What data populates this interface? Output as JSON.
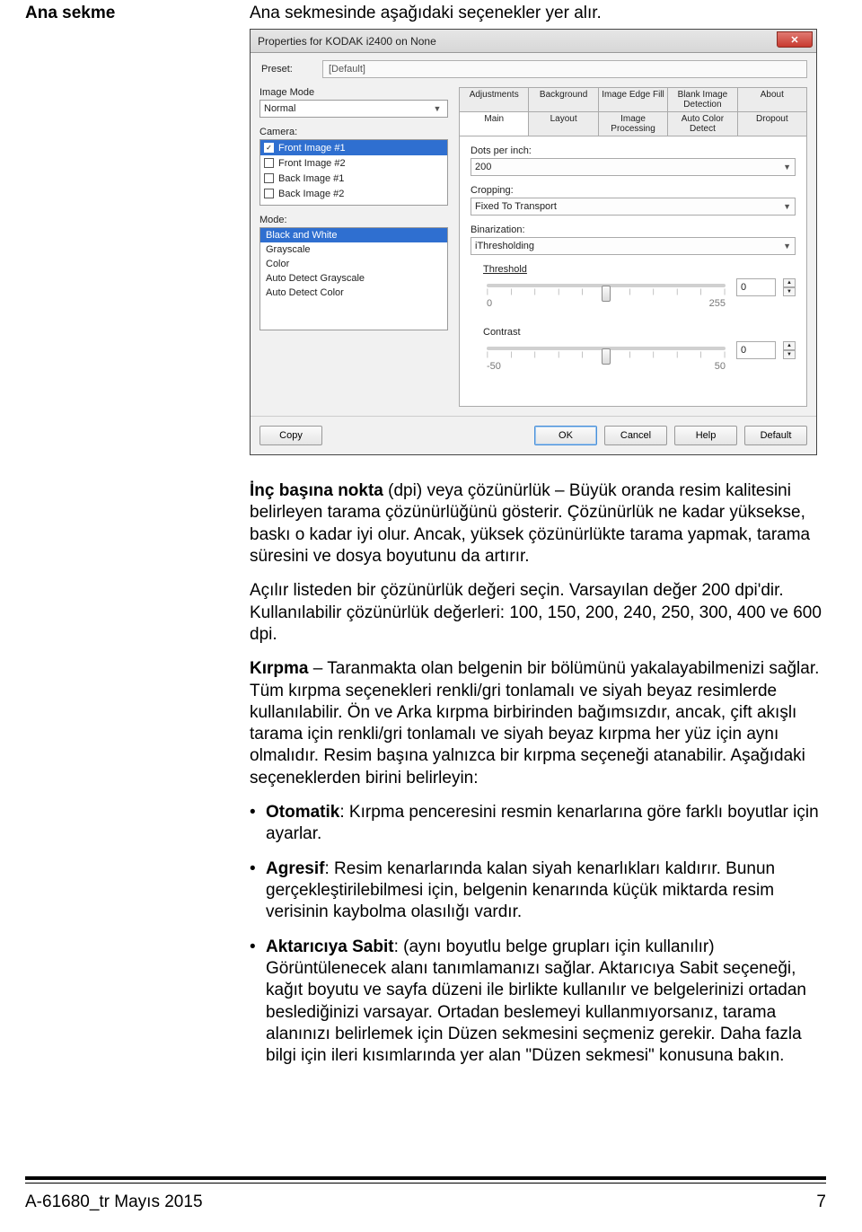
{
  "section_heading": "Ana sekme",
  "intro": "Ana sekmesinde aşağıdaki seçenekler yer alır.",
  "dialog": {
    "title": "Properties for KODAK i2400 on None",
    "close_glyph": "✕",
    "preset_label": "Preset:",
    "preset_value": "[Default]",
    "image_mode_label": "Image Mode",
    "image_mode_value": "Normal",
    "camera_label": "Camera:",
    "camera_items": [
      {
        "checked": true,
        "label": "Front Image #1",
        "selected": true
      },
      {
        "checked": false,
        "label": "Front Image #2",
        "selected": false
      },
      {
        "checked": false,
        "label": "Back Image #1",
        "selected": false
      },
      {
        "checked": false,
        "label": "Back Image #2",
        "selected": false
      }
    ],
    "mode_label": "Mode:",
    "mode_items": [
      {
        "label": "Black and White",
        "selected": true
      },
      {
        "label": "Grayscale",
        "selected": false
      },
      {
        "label": "Color",
        "selected": false
      },
      {
        "label": "Auto Detect Grayscale",
        "selected": false
      },
      {
        "label": "Auto Detect Color",
        "selected": false
      }
    ],
    "tabs_row1": [
      "Adjustments",
      "Background",
      "Image Edge Fill",
      "Blank Image Detection",
      "About"
    ],
    "tabs_row2": [
      "Main",
      "Layout",
      "Image Processing",
      "Auto Color Detect",
      "Dropout"
    ],
    "active_tab": "Main",
    "dpi_label": "Dots per inch:",
    "dpi_value": "200",
    "cropping_label": "Cropping:",
    "cropping_value": "Fixed To Transport",
    "binarization_label": "Binarization:",
    "binarization_value": "iThresholding",
    "threshold_label": "Threshold",
    "threshold_value": "0",
    "threshold_min": "0",
    "threshold_max": "255",
    "contrast_label": "Contrast",
    "contrast_value": "0",
    "contrast_min": "-50",
    "contrast_max": "50",
    "buttons": {
      "copy": "Copy",
      "ok": "OK",
      "cancel": "Cancel",
      "help": "Help",
      "default": "Default"
    }
  },
  "body": {
    "p1a": "İnç başına nokta",
    "p1b": " (dpi) veya çözünürlük – Büyük oranda resim kalitesini belirleyen tarama çözünürlüğünü gösterir. Çözünürlük ne kadar yüksekse, baskı o kadar iyi olur. Ancak, yüksek çözünürlükte tarama yapmak, tarama süresini ve dosya boyutunu da artırır.",
    "p2": "Açılır listeden bir çözünürlük değeri seçin. Varsayılan değer 200 dpi'dir. Kullanılabilir çözünürlük değerleri: 100, 150, 200, 240, 250, 300, 400 ve 600 dpi.",
    "p3a": "Kırpma",
    "p3b": " – Taranmakta olan belgenin bir bölümünü yakalayabilmenizi sağlar. Tüm kırpma seçenekleri renkli/gri tonlamalı ve siyah beyaz resimlerde kullanılabilir. Ön ve Arka kırpma birbirinden bağımsızdır, ancak, çift akışlı tarama için renkli/gri tonlamalı ve siyah beyaz kırpma her yüz için aynı olmalıdır. Resim başına yalnızca bir kırpma seçeneği atanabilir. Aşağıdaki seçeneklerden birini belirleyin:",
    "li1a": "Otomatik",
    "li1b": ": Kırpma penceresini resmin kenarlarına göre farklı boyutlar için ayarlar.",
    "li2a": "Agresif",
    "li2b": ": Resim kenarlarında kalan siyah kenarlıkları kaldırır. Bunun gerçekleştirilebilmesi için, belgenin kenarında küçük miktarda resim verisinin kaybolma olasılığı vardır.",
    "li3a": "Aktarıcıya Sabit",
    "li3b": ": (aynı boyutlu belge grupları için kullanılır) Görüntülenecek alanı tanımlamanızı sağlar. Aktarıcıya Sabit seçeneği, kağıt boyutu ve sayfa düzeni ile birlikte kullanılır ve belgelerinizi ortadan beslediğinizi varsayar. Ortadan beslemeyi kullanmıyorsanız, tarama alanınızı belirlemek için Düzen sekmesini seçmeniz gerekir. Daha fazla bilgi için ileri kısımlarında yer alan \"Düzen sekmesi\" konusuna bakın."
  },
  "footer": {
    "left": "A-61680_tr  Mayıs 2015",
    "right": "7"
  }
}
